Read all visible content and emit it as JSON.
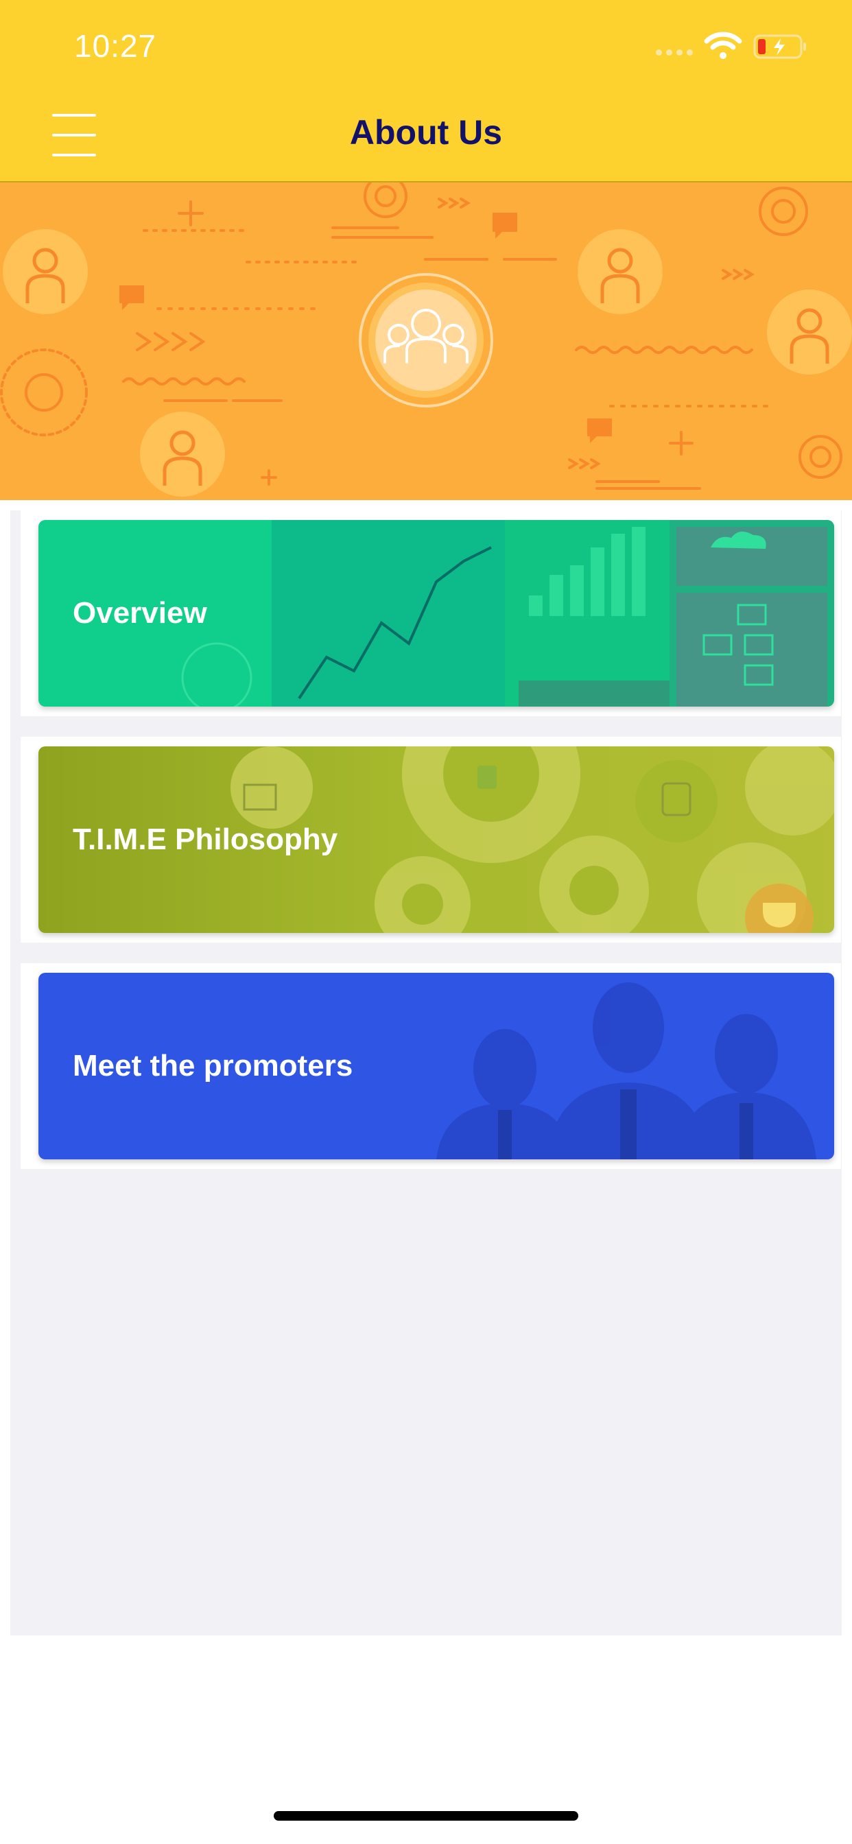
{
  "status_bar": {
    "time": "10:27"
  },
  "header": {
    "title": "About Us"
  },
  "cards": [
    {
      "label": "Overview",
      "color": "#10cf8c"
    },
    {
      "label": "T.I.M.E Philosophy",
      "color": "#97a625"
    },
    {
      "label": "Meet the promoters",
      "color": "#2f55e4"
    }
  ],
  "colors": {
    "nav_bar": "#fed22e",
    "banner": "#fdad3c",
    "title": "#12126b",
    "content_bg": "#f2f2f6"
  },
  "icons": [
    "menu-icon",
    "wifi-icon",
    "battery-charging-icon",
    "team-icon"
  ]
}
